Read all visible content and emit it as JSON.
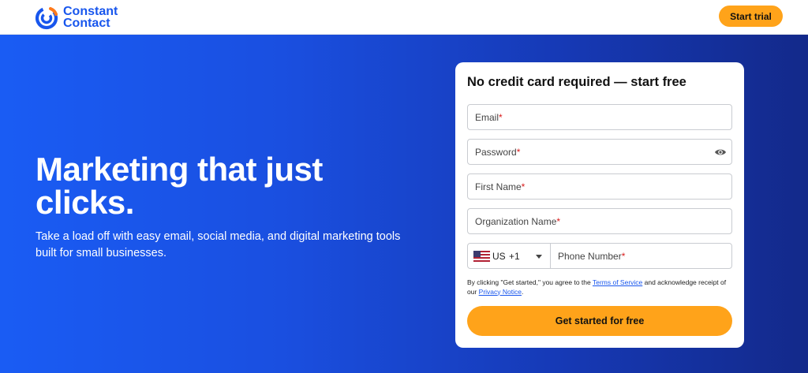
{
  "header": {
    "logo_line1": "Constant",
    "logo_line2": "Contact",
    "start_trial_label": "Start trial"
  },
  "hero": {
    "headline": "Marketing that just clicks.",
    "subtext": "Take a load off with easy email, social media, and digital marketing tools built for small businesses."
  },
  "form": {
    "title": "No credit card required — start free",
    "email_label": "Email",
    "password_label": "Password",
    "first_name_label": "First Name",
    "organization_label": "Organization Name",
    "country_code": "US",
    "dial_code": "+1",
    "phone_label": "Phone Number",
    "required_marker": "*",
    "legal_prefix": "By clicking \"Get started,\" you agree to the ",
    "terms_link": "Terms of Service",
    "legal_middle": " and acknowledge receipt of our ",
    "privacy_link": "Privacy Notice",
    "legal_suffix": ".",
    "submit_label": "Get started for free"
  },
  "colors": {
    "brand_blue": "#1856ed",
    "cta_orange": "#ffa31a",
    "required_red": "#d91b1b"
  },
  "icons": {
    "logo": "constant-contact-logo-icon",
    "password_toggle": "eye-icon",
    "country_flag": "us-flag-icon",
    "dropdown": "chevron-down-icon"
  }
}
